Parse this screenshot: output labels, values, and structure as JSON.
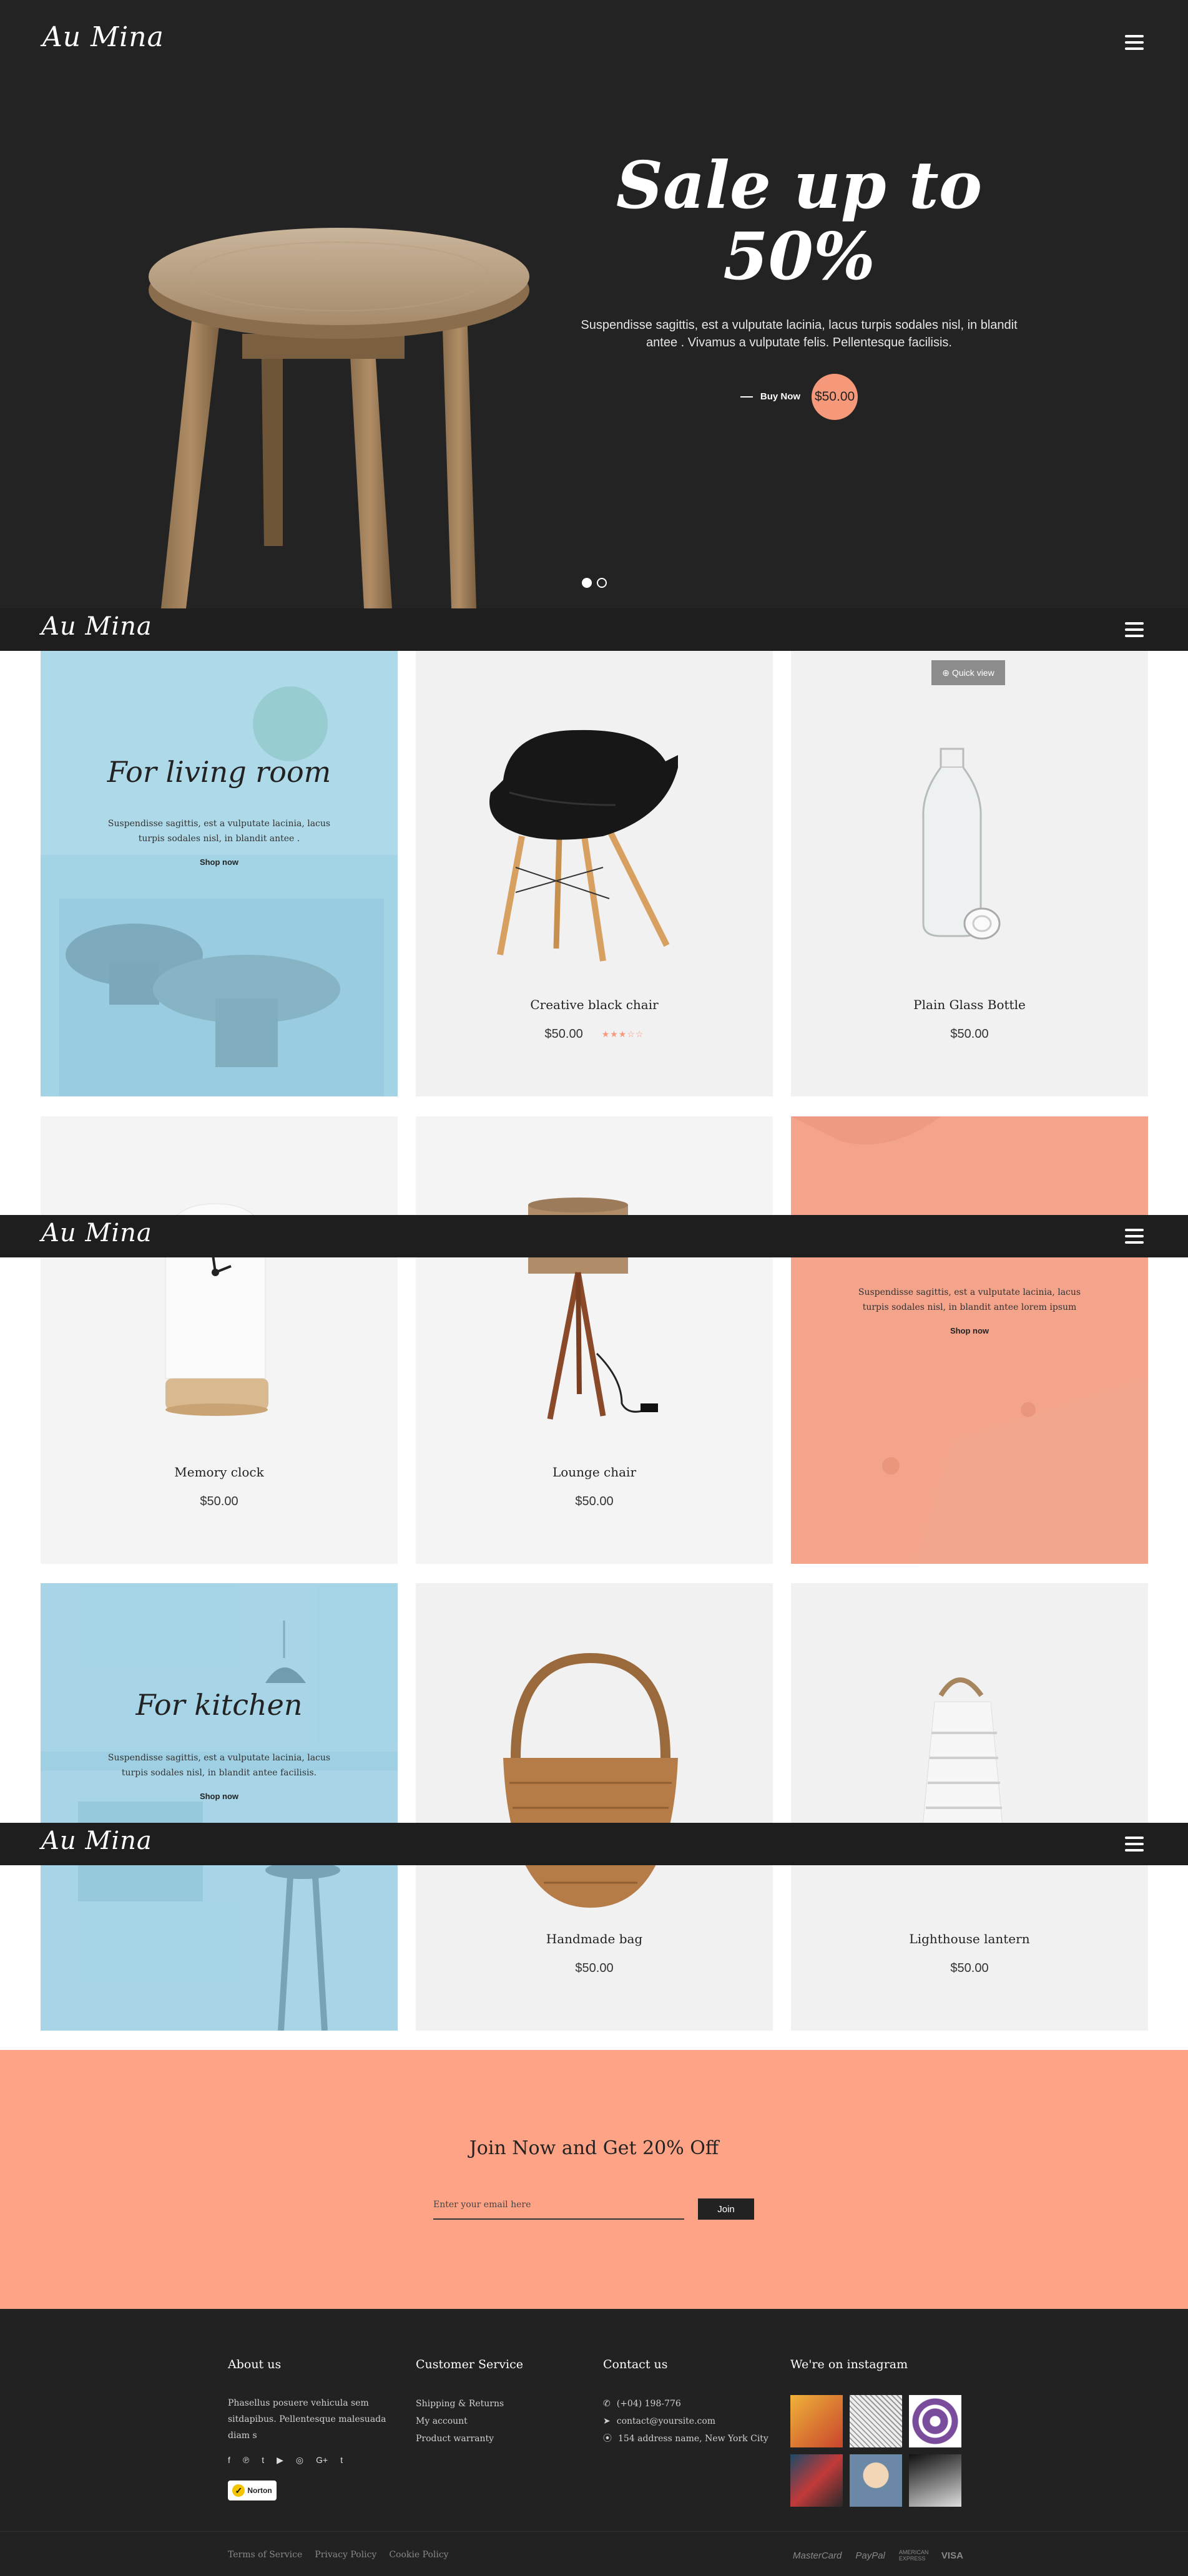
{
  "brand": {
    "logo": "Au Mina"
  },
  "hero": {
    "title": "Sale up to 50%",
    "description": "Suspendisse sagittis, est a vulputate lacinia, lacus turpis sodales nisl, in blandit antee . Vivamus a vulputate felis. Pellentesque facilisis.",
    "buy_label": "Buy Now",
    "price": "$50.00",
    "slides": 2,
    "active_slide": 1
  },
  "grid": {
    "promo_living": {
      "title": "For living room",
      "description": "Suspendisse sagittis, est a vulputate lacinia, lacus turpis sodales nisl, in blandit antee .",
      "link": "Shop now"
    },
    "promo_bedroom": {
      "description": "Suspendisse sagittis, est a vulputate lacinia, lacus turpis sodales nisl, in blandit antee lorem ipsum",
      "link": "Shop now"
    },
    "promo_kitchen": {
      "title": "For kitchen",
      "description": "Suspendisse sagittis, est a vulputate lacinia, lacus turpis sodales nisl, in blandit antee facilisis.",
      "link": "Shop now"
    },
    "quick_view": "Quick view",
    "products": [
      {
        "name": "Creative black chair",
        "price": "$50.00",
        "rating": 3
      },
      {
        "name": "Plain Glass Bottle",
        "price": "$50.00"
      },
      {
        "name": "Memory clock",
        "price": "$50.00"
      },
      {
        "name": "Lounge chair",
        "price": "$50.00"
      },
      {
        "name": "Handmade bag",
        "price": "$50.00"
      },
      {
        "name": "Lighthouse lantern",
        "price": "$50.00"
      }
    ]
  },
  "newsletter": {
    "title": "Join Now and Get 20% Off",
    "placeholder": "Enter your email here",
    "button": "Join"
  },
  "footer": {
    "about": {
      "heading": "About us",
      "text": "Phasellus posuere vehicula sem sitdapibus. Pellentesque malesuada diam s",
      "socials": [
        "f",
        "℗",
        "t",
        "▶",
        "◎",
        "G+",
        "t"
      ],
      "badge": "Norton"
    },
    "service": {
      "heading": "Customer Service",
      "links": [
        "Shipping & Returns",
        "My account",
        "Product warranty"
      ]
    },
    "contact": {
      "heading": "Contact us",
      "phone": "(+04) 198-776",
      "email": "contact@yoursite.com",
      "address": "154 address name, New York City"
    },
    "instagram": {
      "heading": "We're on instagram"
    },
    "legal": [
      "Terms of Service",
      "Privacy Policy",
      "Cookie Policy"
    ],
    "payments": [
      "MasterCard",
      "PayPal",
      "AMERICAN EXPRESS",
      "VISA"
    ]
  },
  "colors": {
    "dark": "#232323",
    "accent": "#f6987a",
    "newsletter_bg": "#fea385",
    "living_overlay": "#9fd3e8",
    "bedroom_overlay": "#f7a28a"
  }
}
